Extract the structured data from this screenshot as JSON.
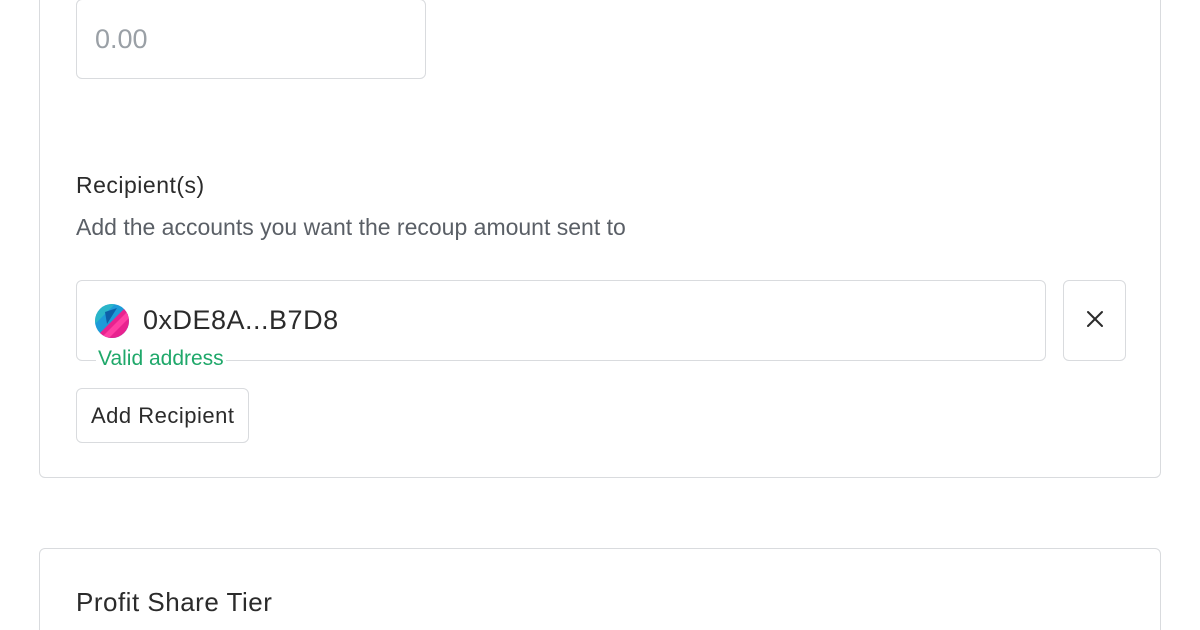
{
  "recoup": {
    "amount_placeholder": "0.00",
    "amount_value": ""
  },
  "recipients": {
    "label": "Recipient(s)",
    "help_text": "Add the accounts you want the recoup amount sent to",
    "items": [
      {
        "address": "0xDE8A...B7D8",
        "status": "Valid address",
        "avatar_icon": "wallet-avatar-icon",
        "remove_icon": "close-icon"
      }
    ],
    "add_button_label": "Add Recipient"
  },
  "profit_share": {
    "title": "Profit Share Tier"
  },
  "colors": {
    "valid": "#1fa86a",
    "border": "#d9dbde",
    "text": "#2b2b2b",
    "muted": "#5a5f66",
    "placeholder": "#9aa0a6"
  }
}
